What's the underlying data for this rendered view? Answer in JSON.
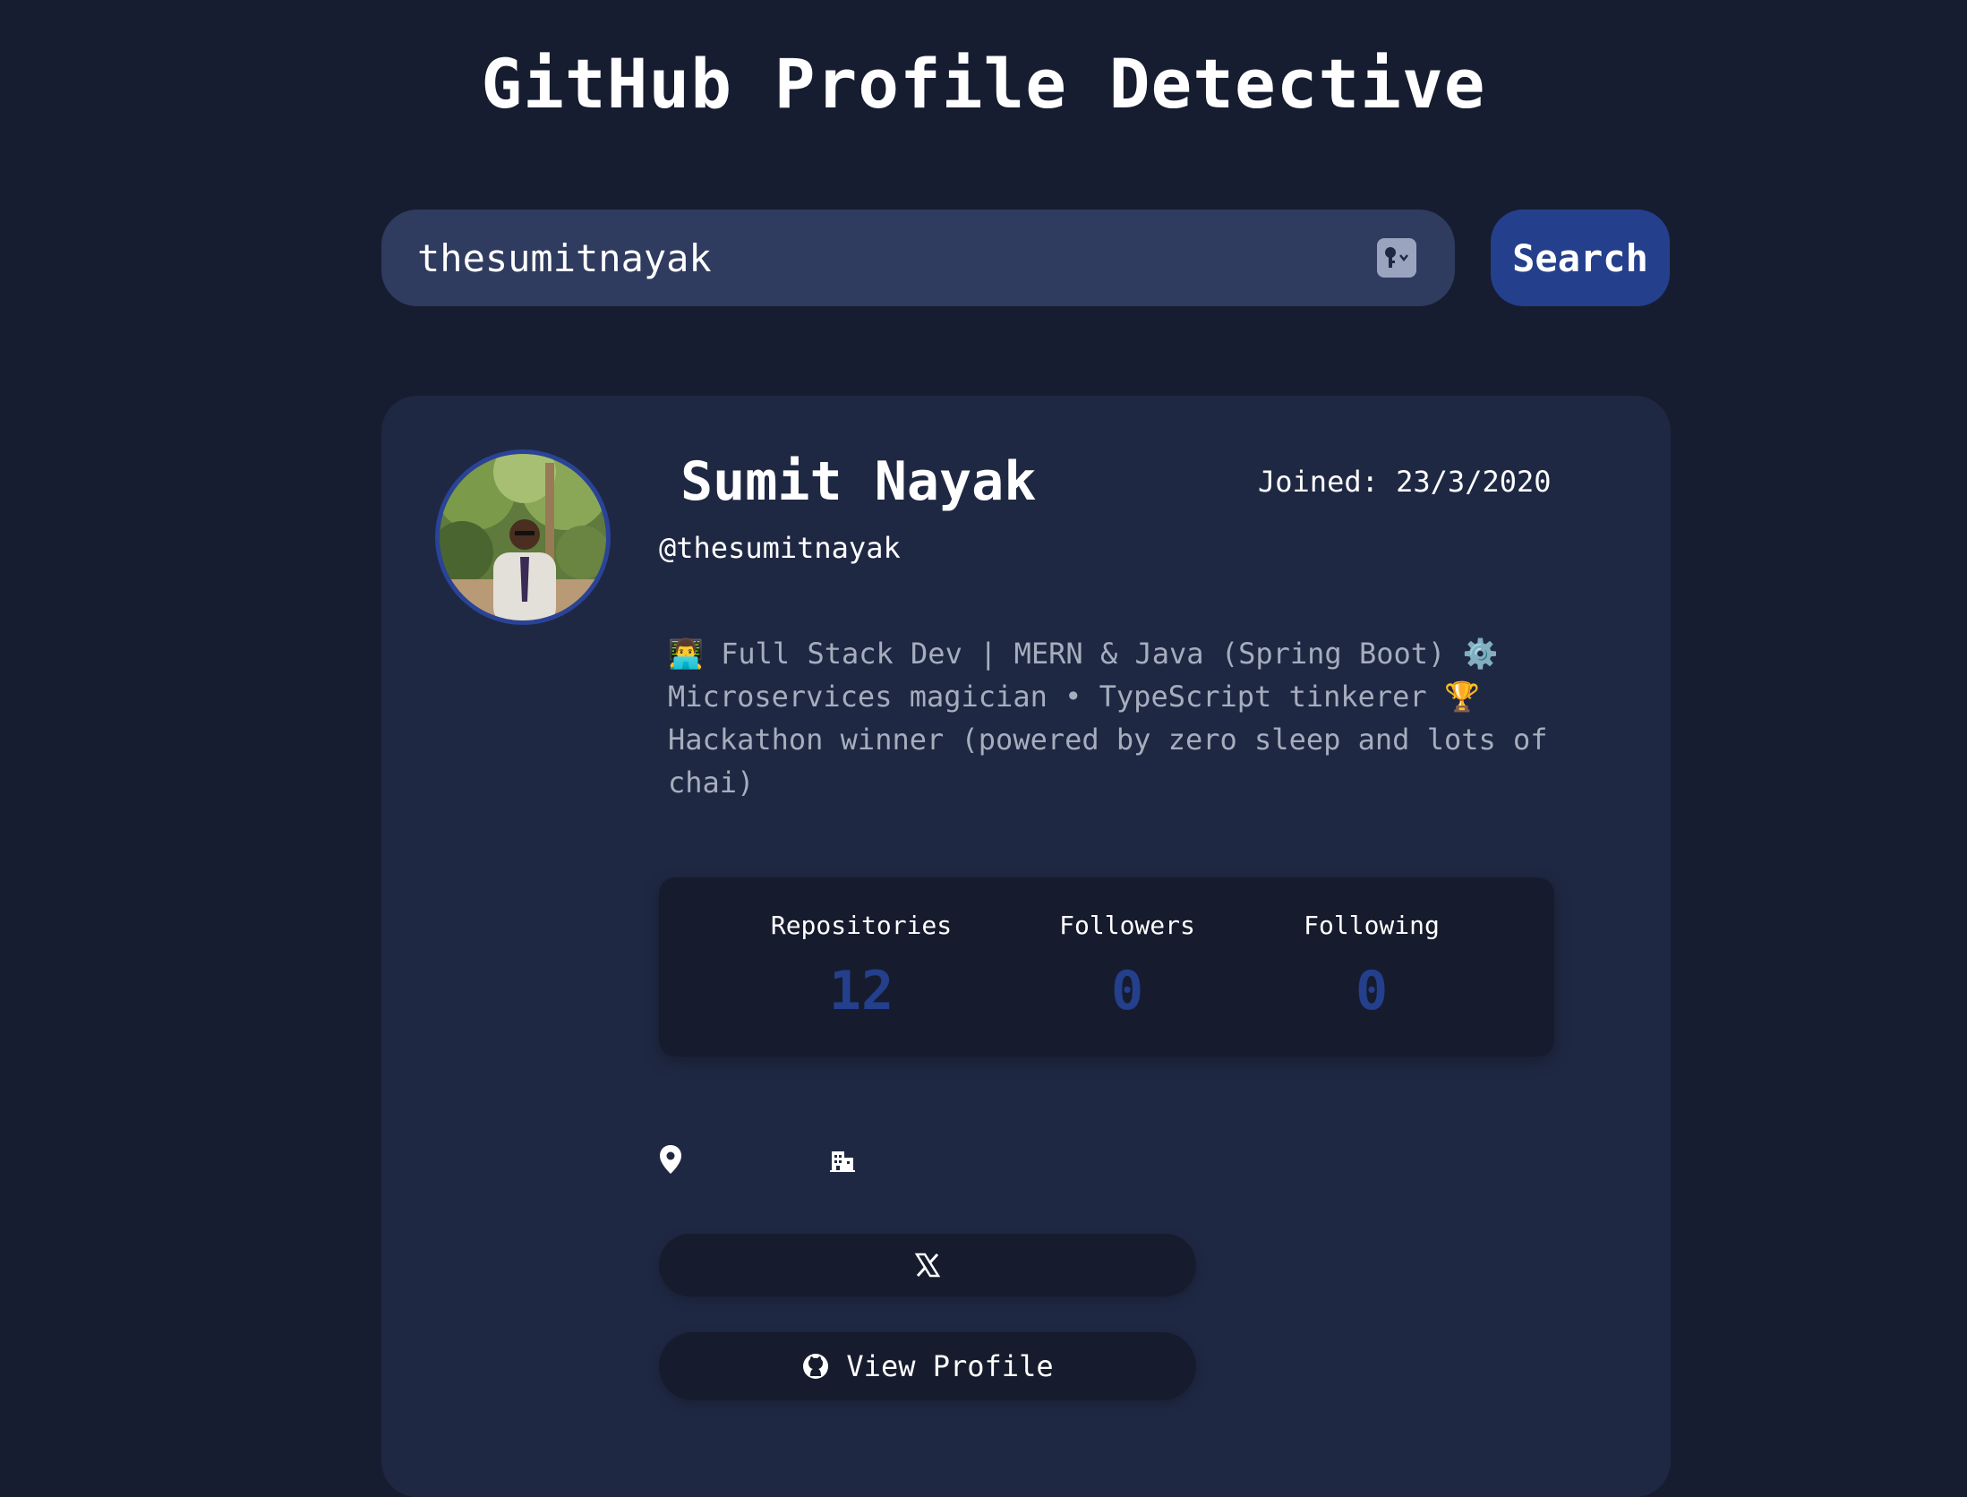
{
  "header": {
    "title": "GitHub Profile Detective"
  },
  "search": {
    "value": "thesumitnayak",
    "button_label": "Search"
  },
  "profile": {
    "name": "Sumit Nayak",
    "handle": "@thesumitnayak",
    "joined": "Joined: 23/3/2020",
    "bio_lines": [
      "👨‍💻 Full Stack Dev | MERN & Java (Spring Boot) ⚙️",
      "Microservices magician • TypeScript tinkerer 🏆",
      "Hackathon winner (powered by zero sleep and lots of",
      "chai)"
    ],
    "stats": [
      {
        "label": "Repositories",
        "value": "12"
      },
      {
        "label": "Followers",
        "value": "0"
      },
      {
        "label": "Following",
        "value": "0"
      }
    ],
    "icons": {
      "location": "location-pin-icon",
      "company": "building-icon",
      "twitter": "x-logo-icon",
      "github": "github-icon",
      "password_manager": "key-icon"
    },
    "view_profile_label": "View Profile"
  },
  "colors": {
    "background": "#171d30",
    "card": "#1f2843",
    "input": "#2f3b5f",
    "accent": "#243f8c",
    "panel": "#161c2d",
    "muted_text": "#a6adbd"
  }
}
